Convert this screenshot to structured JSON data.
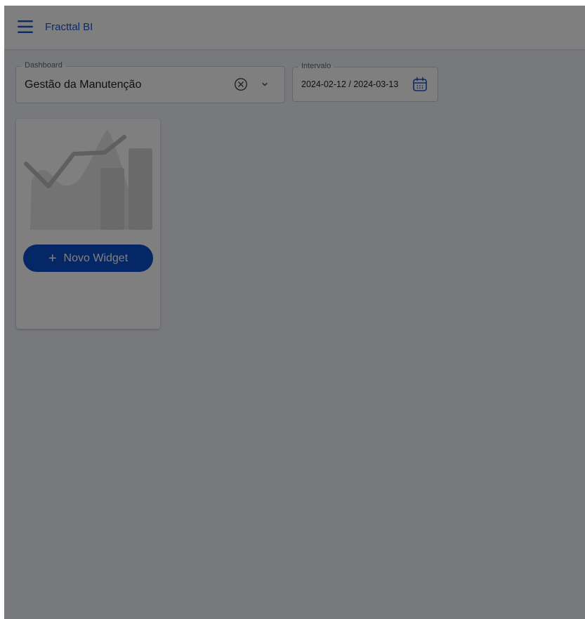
{
  "app": {
    "title": "Fracttal BI",
    "accent_color": "#2155c9",
    "icons": {
      "menu": "hamburger-menu-icon"
    }
  },
  "filters": {
    "dashboard": {
      "label": "Dashboard",
      "value": "Gestão da Manutenção",
      "icons": [
        "clear-circle-icon",
        "chevron-down-icon"
      ]
    },
    "interval": {
      "label": "Intervalo",
      "value": "2024-02-12 / 2024-03-13",
      "icon": "calendar-icon"
    }
  },
  "widget_card": {
    "placeholder_icon": "chart-placeholder-icon",
    "button_label": "Novo Widget",
    "button_icon": "plus-icon",
    "button_color": "#0d4fcc"
  },
  "overlay": {
    "visible": true,
    "color": "#000000",
    "opacity": 0.5
  }
}
